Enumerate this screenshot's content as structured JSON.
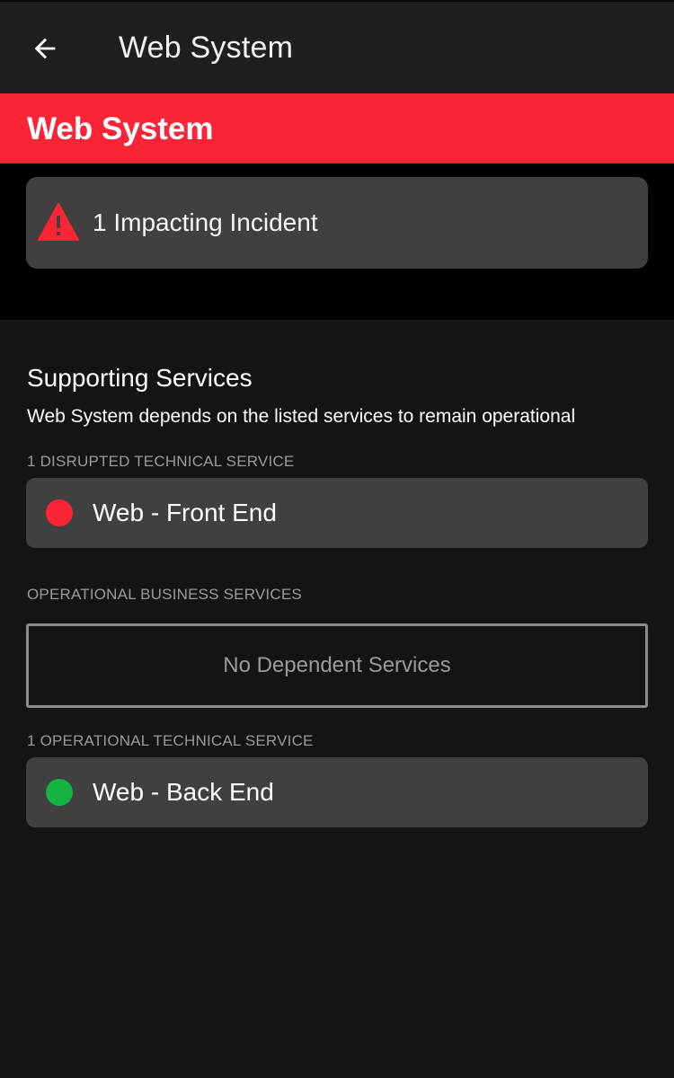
{
  "app_bar": {
    "title": "Web System",
    "back_icon": "arrow-left-icon"
  },
  "banner": {
    "title": "Web System",
    "color": "#fb2436"
  },
  "incident": {
    "icon": "warning-triangle-icon",
    "text": "1 Impacting Incident"
  },
  "supporting": {
    "title": "Supporting Services",
    "subtitle": "Web System depends on the listed services to remain operational"
  },
  "groups": {
    "disrupted_technical": {
      "label": "1 DISRUPTED TECHNICAL SERVICE",
      "items": [
        {
          "name": "Web - Front End",
          "status_color": "#fb2436"
        }
      ]
    },
    "operational_business": {
      "label": "OPERATIONAL BUSINESS SERVICES",
      "empty_text": "No Dependent Services"
    },
    "operational_technical": {
      "label": "1 OPERATIONAL TECHNICAL SERVICE",
      "items": [
        {
          "name": "Web - Back End",
          "status_color": "#12b340"
        }
      ]
    }
  }
}
